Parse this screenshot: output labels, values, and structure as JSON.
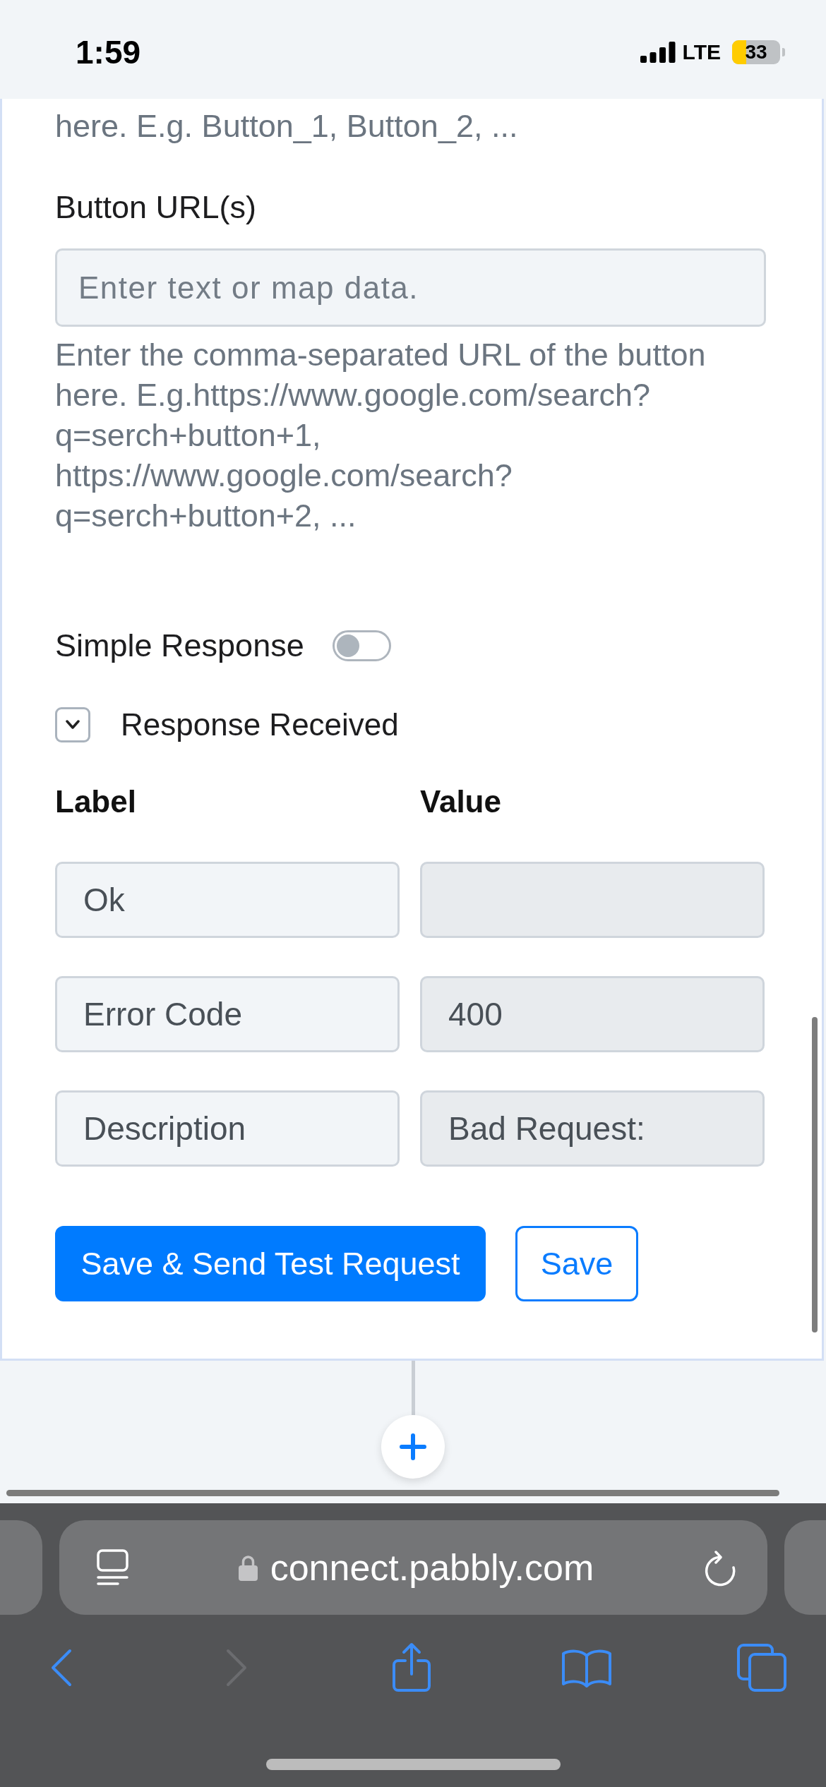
{
  "status_bar": {
    "time": "1:59",
    "network": "LTE",
    "battery": "33"
  },
  "form": {
    "previous_help": "here. E.g. Button_1, Button_2, ...",
    "button_urls": {
      "label": "Button URL(s)",
      "placeholder": "Enter text or map data.",
      "help": "Enter the comma-separated URL of the button here. E.g.https://www.google.com/search?q=serch+button+1, https://www.google.com/search?q=serch+button+2, ..."
    },
    "simple_response": {
      "label": "Simple Response",
      "on": false
    },
    "response_received": {
      "label": "Response Received",
      "expanded": true
    },
    "columns": [
      "Label",
      "Value"
    ],
    "rows": [
      {
        "label": "Ok",
        "value_disabled": true
      },
      {
        "label": "Error Code",
        "value": "400",
        "value_disabled": true
      },
      {
        "label": "Description",
        "value": "Bad Request:",
        "value_disabled": true
      }
    ],
    "buttons": [
      {
        "label": "Save & Send Test Request",
        "kind": "primary"
      },
      {
        "label": "Save",
        "kind": "outline"
      }
    ]
  },
  "browser": {
    "url": "connect.pabbly.com",
    "forward_disabled": true
  }
}
